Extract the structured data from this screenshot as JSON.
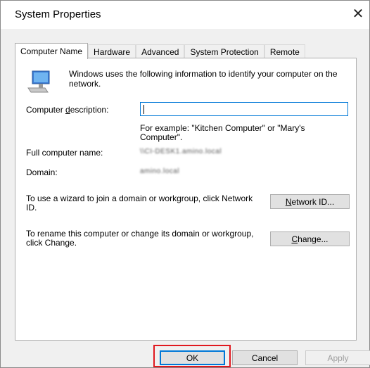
{
  "window": {
    "title": "System Properties",
    "close_glyph": "✕"
  },
  "tabs": [
    {
      "label": "Computer Name",
      "active": true
    },
    {
      "label": "Hardware",
      "active": false
    },
    {
      "label": "Advanced",
      "active": false
    },
    {
      "label": "System Protection",
      "active": false
    },
    {
      "label": "Remote",
      "active": false
    }
  ],
  "panel": {
    "intro_text": "Windows uses the following information to identify your computer on the network.",
    "description_label": "Computer description:",
    "description_value": "",
    "example_text": "For example: \"Kitchen Computer\" or \"Mary's Computer\".",
    "full_name_label": "Full computer name:",
    "full_name_value": "\\\\CI-DESK1.amino.local",
    "domain_label": "Domain:",
    "domain_value": "amino.local",
    "network_text": "To use a wizard to join a domain or workgroup, click Network ID.",
    "network_button": "Network ID...",
    "rename_text": "To rename this computer or change its domain or workgroup, click Change.",
    "change_button": "Change..."
  },
  "footer": {
    "ok": "OK",
    "cancel": "Cancel",
    "apply": "Apply"
  },
  "icons": {
    "computer": "computer-icon",
    "close": "close-icon"
  },
  "colors": {
    "focus": "#0078d7",
    "highlight": "#e0181f"
  }
}
